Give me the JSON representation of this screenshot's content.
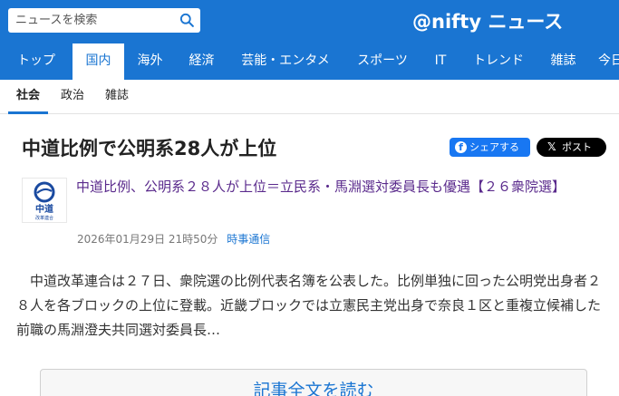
{
  "search": {
    "placeholder": "ニュースを検索"
  },
  "logo": {
    "text": "@nifty ニュース"
  },
  "nav": {
    "items": [
      {
        "label": "トップ",
        "active": false
      },
      {
        "label": "国内",
        "active": true
      },
      {
        "label": "海外",
        "active": false
      },
      {
        "label": "経済",
        "active": false
      },
      {
        "label": "芸能・エンタメ",
        "active": false
      },
      {
        "label": "スポーツ",
        "active": false
      },
      {
        "label": "IT",
        "active": false
      },
      {
        "label": "トレンド",
        "active": false
      },
      {
        "label": "雑誌",
        "active": false
      },
      {
        "label": "今日",
        "active": false
      }
    ]
  },
  "subnav": {
    "items": [
      {
        "label": "社会",
        "active": true
      },
      {
        "label": "政治",
        "active": false
      },
      {
        "label": "雑誌",
        "active": false
      }
    ]
  },
  "article": {
    "title": "中道比例で公明系28人が上位",
    "share": {
      "facebook": "シェアする",
      "x": "ポスト"
    },
    "source_logo": {
      "main": "中道",
      "sub": "改革連合"
    },
    "headline": "中道比例、公明系２８人が上位＝立民系・馬淵選対委員長も優遇【２６衆院選】",
    "date": "2026年01月29日 21時50分",
    "publisher": "時事通信",
    "summary": "　中道改革連合は２７日、衆院選の比例代表名簿を公表した。比例単独に回った公明党出身者２８人を各ブロックの上位に登載。近畿ブロックでは立憲民主党出身で奈良１区と重複立候補した前職の馬淵澄夫共同選対委員長…",
    "read_more": "記事全文を読む"
  },
  "colors": {
    "brand": "#1a75d2",
    "facebook": "#1877f2",
    "x": "#000000",
    "link_visited": "#5a2a8c"
  }
}
